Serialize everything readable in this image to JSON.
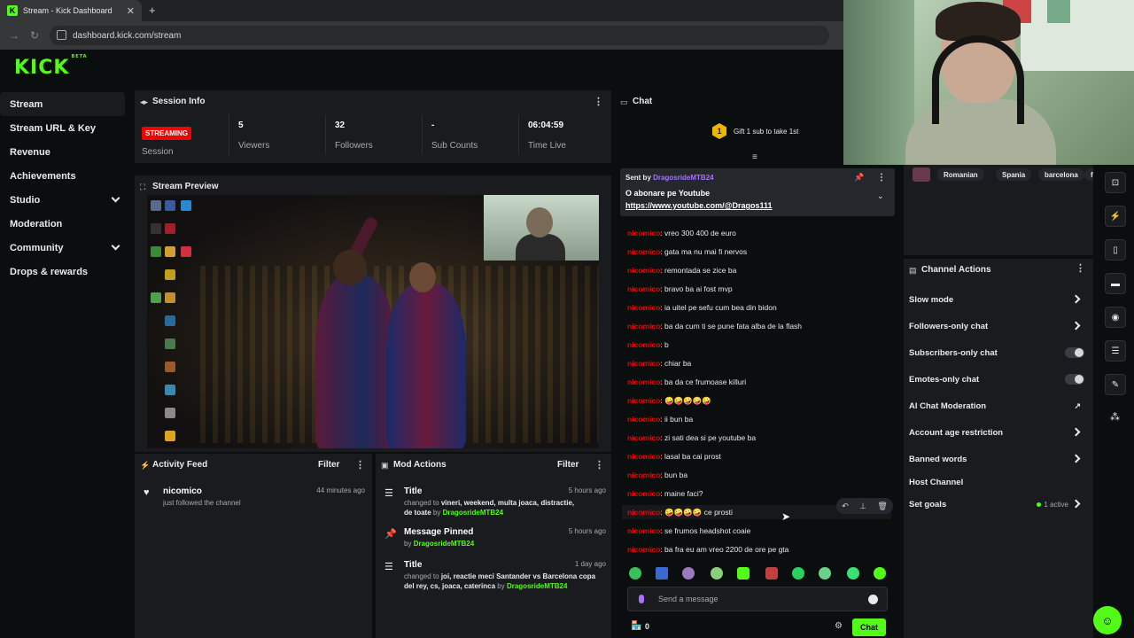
{
  "browser": {
    "tab_title": "Stream - Kick Dashboard",
    "url": "dashboard.kick.com/stream"
  },
  "brand": {
    "logo": "KICK",
    "beta": "BETA",
    "accent": "#53fc18"
  },
  "sidebar": {
    "items": [
      {
        "label": "Stream"
      },
      {
        "label": "Stream URL & Key"
      },
      {
        "label": "Revenue"
      },
      {
        "label": "Achievements"
      },
      {
        "label": "Studio"
      },
      {
        "label": "Moderation"
      },
      {
        "label": "Community"
      },
      {
        "label": "Drops & rewards"
      }
    ]
  },
  "session": {
    "title": "Session Info",
    "status": "STREAMING",
    "stats": [
      {
        "label": "Session",
        "value": ""
      },
      {
        "label": "Viewers",
        "value": "5"
      },
      {
        "label": "Followers",
        "value": "32"
      },
      {
        "label": "Sub Counts",
        "value": "-"
      },
      {
        "label": "Time Live",
        "value": "06:04:59"
      }
    ]
  },
  "preview": {
    "title": "Stream Preview"
  },
  "activity": {
    "title": "Activity Feed",
    "filter": "Filter",
    "items": [
      {
        "name": "nicomico",
        "detail": "just followed the channel",
        "time": "44 minutes ago"
      }
    ]
  },
  "mod": {
    "title": "Mod Actions",
    "filter": "Filter",
    "items": [
      {
        "title": "Title",
        "prefix": "changed to",
        "value": "vineri, weekend, multa joaca, distractie, de toate",
        "by": "by",
        "user": "DragosrideMTB24",
        "time": "5 hours ago"
      },
      {
        "title": "Message Pinned",
        "prefix": "",
        "value": "",
        "by": "by",
        "user": "DragosrideMTB24",
        "time": "5 hours ago"
      },
      {
        "title": "Title",
        "prefix": "changed to",
        "value": "joi, reactie meci Santander vs Barcelona copa del rey, cs, joaca, caterinca",
        "by": "by",
        "user": "DragosrideMTB24",
        "time": "1 day ago"
      }
    ]
  },
  "chat": {
    "title": "Chat",
    "gift_text": "Gift 1 sub to take 1st",
    "gift_count": "1",
    "pinned": {
      "sent_by": "Sent by",
      "user": "DragosrideMTB24",
      "line1": "O abonare pe Youtube",
      "line2": "https://www.youtube.com/@Dragos111"
    },
    "messages": [
      {
        "user": "nicomico",
        "text": "vreo 300 400 de euro"
      },
      {
        "user": "nicomico",
        "text": "gata ma nu mai fi nervos"
      },
      {
        "user": "nicomico",
        "text": "remontada se zice ba"
      },
      {
        "user": "nicomico",
        "text": "bravo ba ai fost mvp"
      },
      {
        "user": "nicomico",
        "text": "ia uitel pe sefu cum bea din bidon"
      },
      {
        "user": "nicomico",
        "text": "ba da cum ti se pune fata alba de la flash"
      },
      {
        "user": "nicomico",
        "text": "b"
      },
      {
        "user": "nicomico",
        "text": "chiar ba"
      },
      {
        "user": "nicomico",
        "text": "ba da ce frumoase killuri"
      },
      {
        "user": "nicomico",
        "text": "🤪🤪🤪🤪🤪"
      },
      {
        "user": "nicomico",
        "text": "ii bun ba"
      },
      {
        "user": "nicomico",
        "text": "zi sati dea si pe youtube ba"
      },
      {
        "user": "nicomico",
        "text": "lasal ba cai prost"
      },
      {
        "user": "nicomico",
        "text": "bun ba"
      },
      {
        "user": "nicomico",
        "text": "maine faci?"
      },
      {
        "user": "nicomico",
        "text": "🤪🤪🤪🤪 ce prosti"
      },
      {
        "user": "nicomico",
        "text": "se frumos headshot coaie"
      },
      {
        "user": "nicomico",
        "text": "ba fra eu am vreo 2200 de ore pe gta"
      }
    ],
    "input_placeholder": "Send a message",
    "points": "0",
    "send_label": "Chat"
  },
  "tags": [
    "Romanian",
    "Spania",
    "barcelona",
    "fo"
  ],
  "channel_actions": {
    "title": "Channel Actions",
    "rows": [
      {
        "label": "Slow mode",
        "kind": "chevron"
      },
      {
        "label": "Followers-only chat",
        "kind": "chevron"
      },
      {
        "label": "Subscribers-only chat",
        "kind": "toggle"
      },
      {
        "label": "Emotes-only chat",
        "kind": "toggle"
      },
      {
        "label": "AI Chat Moderation",
        "kind": "external"
      },
      {
        "label": "Account age restriction",
        "kind": "chevron"
      },
      {
        "label": "Banned words",
        "kind": "chevron"
      },
      {
        "label": "Host Channel",
        "kind": "none"
      },
      {
        "label": "Set goals",
        "kind": "chevron",
        "badge": "1 active"
      }
    ]
  }
}
